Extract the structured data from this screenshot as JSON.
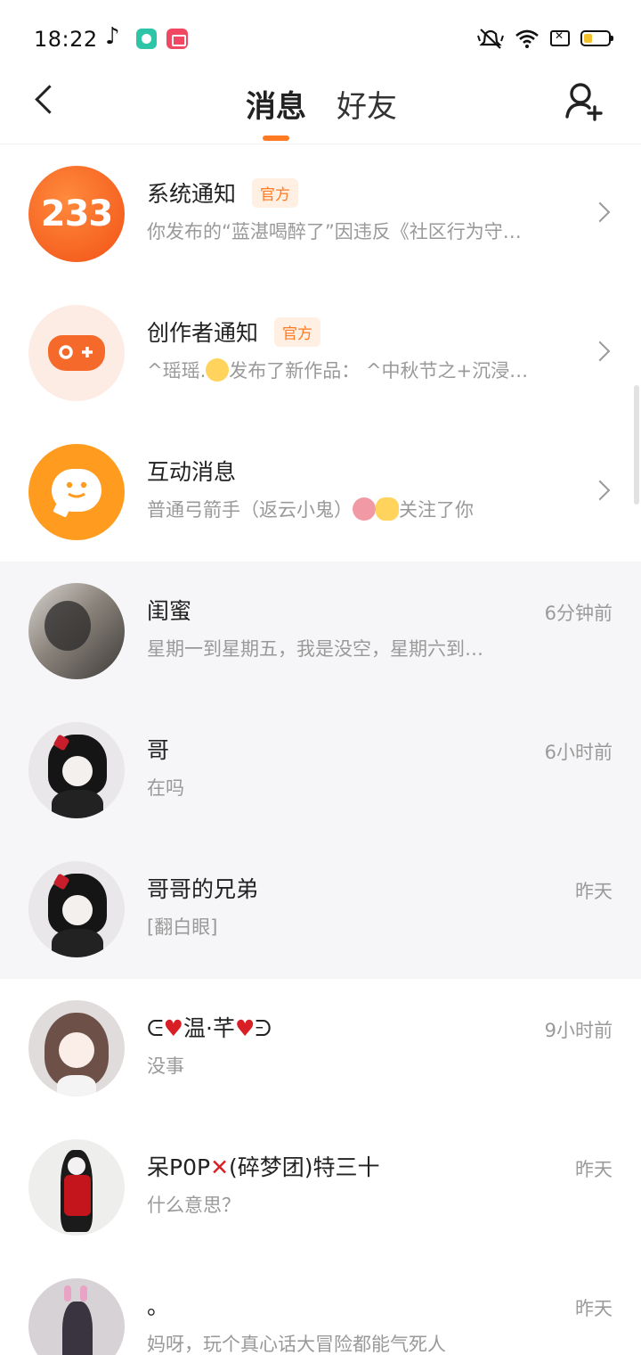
{
  "status_bar": {
    "time": "18:22",
    "icons": [
      "music-note-icon",
      "chat-app-icon",
      "video-app-icon",
      "mute-icon",
      "wifi-icon",
      "sim-off-icon",
      "battery-icon"
    ]
  },
  "header": {
    "tabs": [
      {
        "label": "消息",
        "active": true
      },
      {
        "label": "好友",
        "active": false
      }
    ],
    "accent_color": "#ff7a22"
  },
  "notifications": [
    {
      "title": "系统通知",
      "badge": "官方",
      "preview": "你发布的“蓝湛喝醉了”因违反《社区行为守…",
      "avatar_text": "233"
    },
    {
      "title": "创作者通知",
      "badge": "官方",
      "preview_before": "^瑶瑶.",
      "preview_after": "发布了新作品： ^中秋节之+沉浸…"
    },
    {
      "title": "互动消息",
      "preview_before": "普通弓箭手（返云小鬼）",
      "preview_after": "关注了你"
    }
  ],
  "chats": [
    {
      "name": "闺蜜",
      "preview": "星期一到星期五，我是没空，星期六到…",
      "time": "6分钟前",
      "pinned": true
    },
    {
      "name": "哥",
      "preview": "在吗",
      "time": "6小时前",
      "pinned": true
    },
    {
      "name": "哥哥的兄弟",
      "preview": "[翻白眼]",
      "time": "昨天",
      "pinned": true
    },
    {
      "name_a": "ᕮ",
      "name_b": "温·芊",
      "name_c": "ᕭ",
      "preview": "没事",
      "time": "9小时前",
      "pinned": false
    },
    {
      "name_a": "呆P0P",
      "name_b": "(碎梦团)特三十",
      "preview": "什么意思？",
      "time": "昨天",
      "pinned": false
    },
    {
      "name": "。",
      "preview": "妈呀，玩个真心话大冒险都能气死人",
      "time": "昨天",
      "pinned": false
    }
  ]
}
